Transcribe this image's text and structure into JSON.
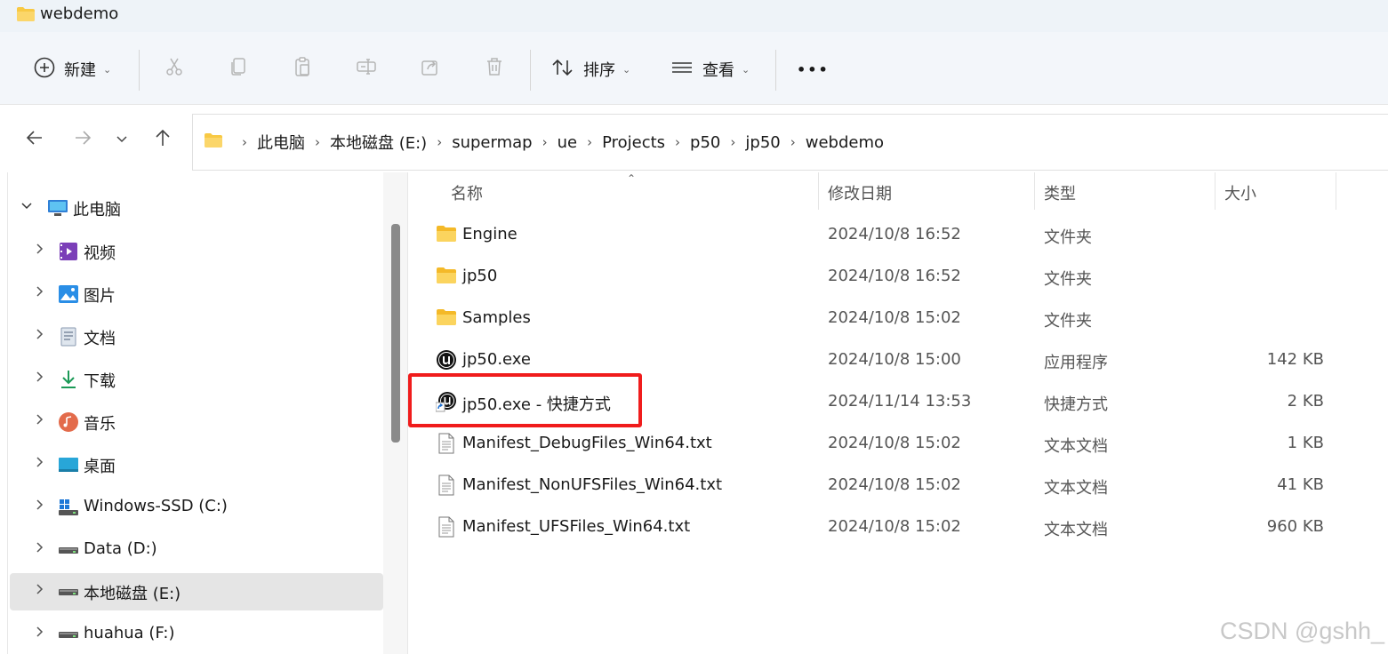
{
  "window": {
    "title": "webdemo"
  },
  "toolbar": {
    "new_label": "新建",
    "sort_label": "排序",
    "view_label": "查看",
    "more_label": "•••"
  },
  "breadcrumb": [
    "此电脑",
    "本地磁盘 (E:)",
    "supermap",
    "ue",
    "Projects",
    "p50",
    "jp50",
    "webdemo"
  ],
  "sidebar": {
    "root": "此电脑",
    "items": [
      {
        "label": "视频",
        "icon": "video-icon"
      },
      {
        "label": "图片",
        "icon": "pictures-icon"
      },
      {
        "label": "文档",
        "icon": "documents-icon"
      },
      {
        "label": "下载",
        "icon": "downloads-icon"
      },
      {
        "label": "音乐",
        "icon": "music-icon"
      },
      {
        "label": "桌面",
        "icon": "desktop-icon"
      },
      {
        "label": "Windows-SSD (C:)",
        "icon": "windows-drive-icon"
      },
      {
        "label": "Data (D:)",
        "icon": "drive-icon"
      },
      {
        "label": "本地磁盘 (E:)",
        "icon": "drive-icon",
        "selected": true
      },
      {
        "label": "huahua (F:)",
        "icon": "drive-icon"
      }
    ]
  },
  "columns": {
    "name": "名称",
    "date": "修改日期",
    "type": "类型",
    "size": "大小"
  },
  "files": [
    {
      "name": "Engine",
      "date": "2024/10/8 16:52",
      "type": "文件夹",
      "size": "",
      "icon": "folder-icon"
    },
    {
      "name": "jp50",
      "date": "2024/10/8 16:52",
      "type": "文件夹",
      "size": "",
      "icon": "folder-icon"
    },
    {
      "name": "Samples",
      "date": "2024/10/8 15:02",
      "type": "文件夹",
      "size": "",
      "icon": "folder-icon"
    },
    {
      "name": "jp50.exe",
      "date": "2024/10/8 15:00",
      "type": "应用程序",
      "size": "142 KB",
      "icon": "unreal-app-icon"
    },
    {
      "name": "jp50.exe - 快捷方式",
      "date": "2024/11/14 13:53",
      "type": "快捷方式",
      "size": "2 KB",
      "icon": "unreal-shortcut-icon",
      "highlighted": true
    },
    {
      "name": "Manifest_DebugFiles_Win64.txt",
      "date": "2024/10/8 15:02",
      "type": "文本文档",
      "size": "1 KB",
      "icon": "text-file-icon"
    },
    {
      "name": "Manifest_NonUFSFiles_Win64.txt",
      "date": "2024/10/8 15:02",
      "type": "文本文档",
      "size": "41 KB",
      "icon": "text-file-icon"
    },
    {
      "name": "Manifest_UFSFiles_Win64.txt",
      "date": "2024/10/8 15:02",
      "type": "文本文档",
      "size": "960 KB",
      "icon": "text-file-icon"
    }
  ],
  "watermark": "CSDN @gshh_",
  "colors": {
    "highlight": "#f01c1c",
    "folder": "#f8c944",
    "selection": "#e5e5e5"
  }
}
